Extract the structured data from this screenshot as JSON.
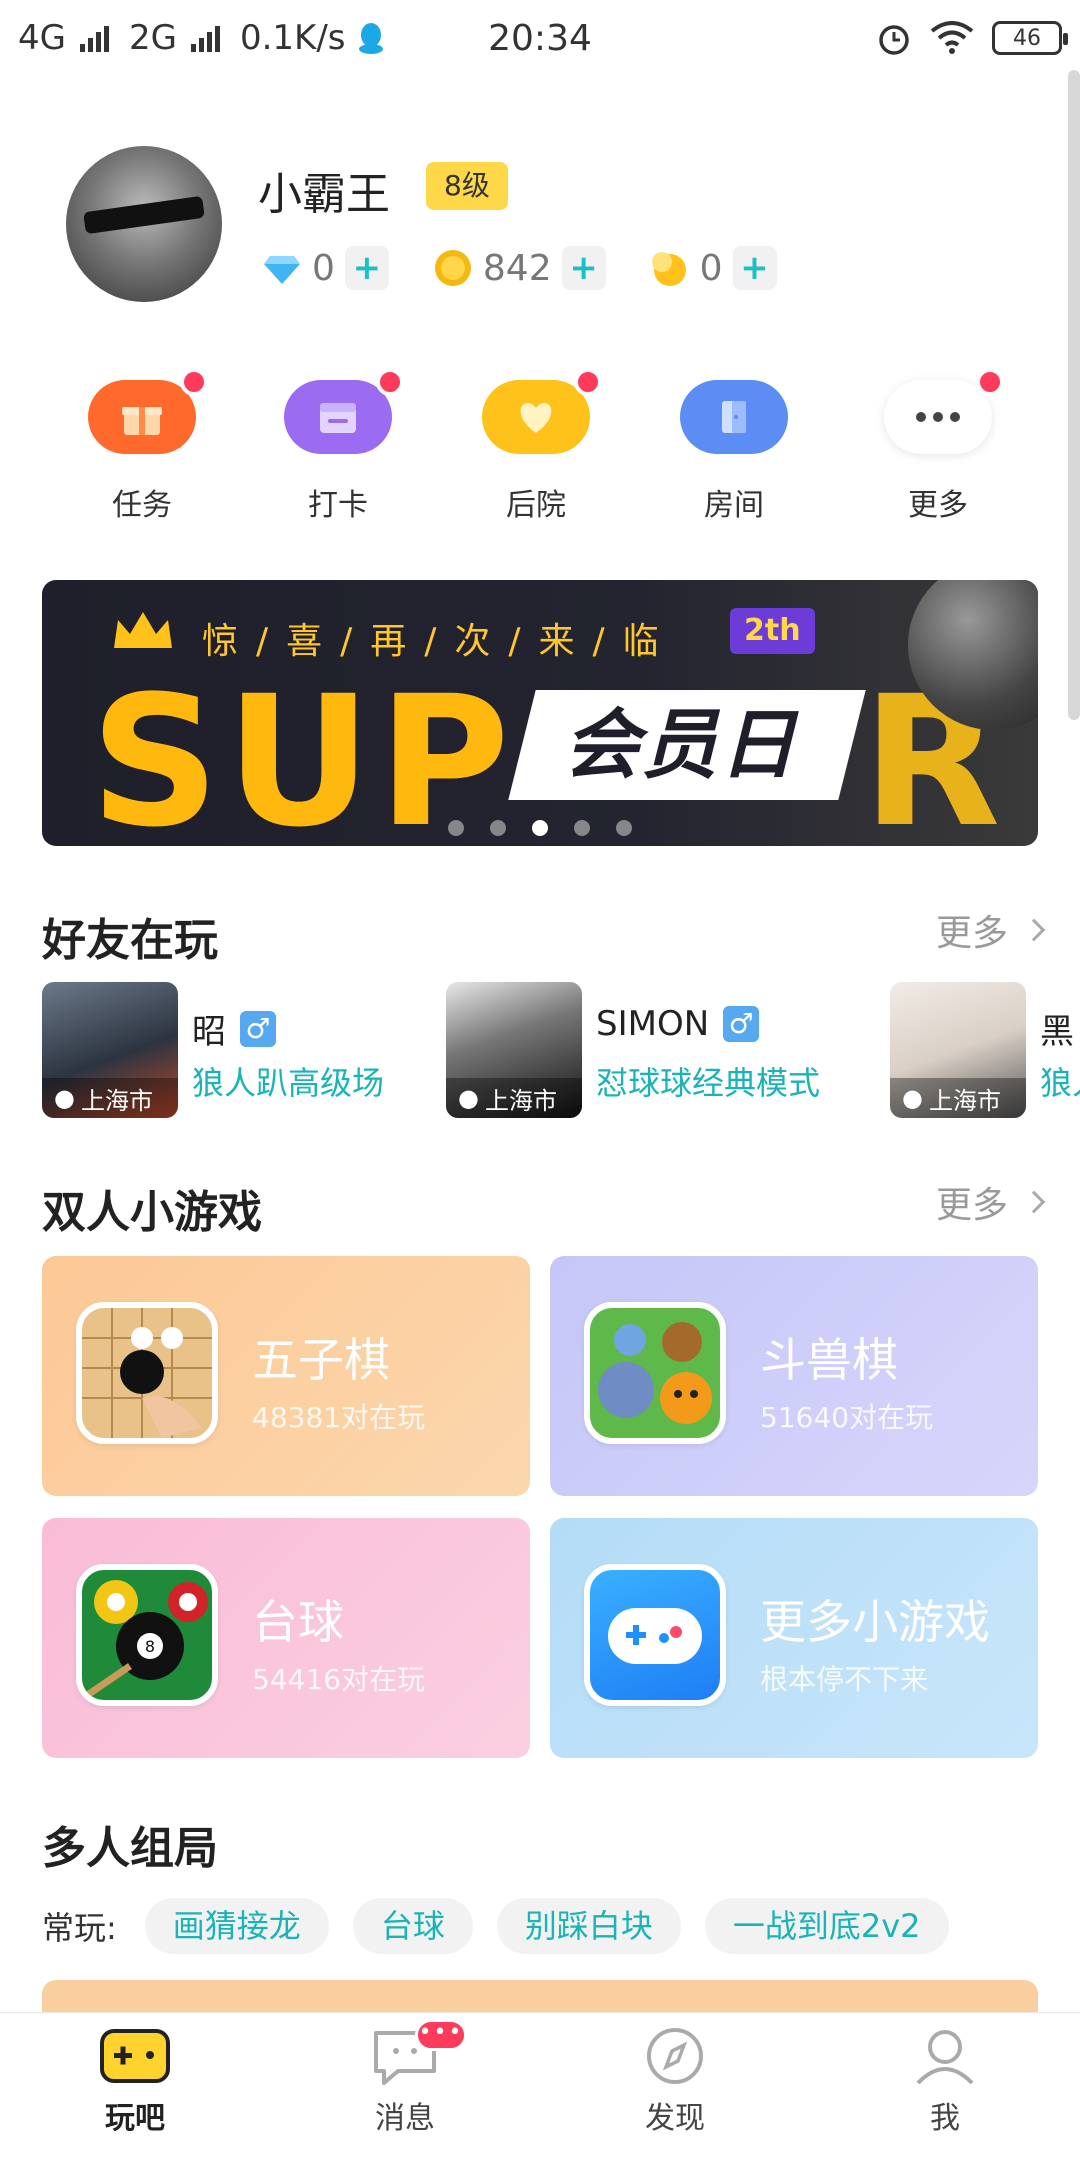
{
  "status_bar": {
    "network": "4G",
    "network2": "2G",
    "speed": "0.1K/s",
    "time": "20:34",
    "battery": "46"
  },
  "profile": {
    "name": "小霸王",
    "level": "8级",
    "diamonds": "0",
    "coins": "842",
    "moons": "0"
  },
  "shortcuts": [
    {
      "label": "任务",
      "color": "#ff6a2c"
    },
    {
      "label": "打卡",
      "color": "#9b6cf2"
    },
    {
      "label": "后院",
      "color": "#ffc21a"
    },
    {
      "label": "房间",
      "color": "#5b8df5"
    },
    {
      "label": "更多",
      "color": "#ffffff"
    }
  ],
  "banner": {
    "top_text": "惊/喜/再/次/来/临",
    "badge": "2th",
    "big_left": "SUP",
    "big_right": "R",
    "slogan": "会员日"
  },
  "friends_section": {
    "title": "好友在玩",
    "more": "更多"
  },
  "friends": [
    {
      "name": "昭",
      "gender": "♂",
      "game": "狼人趴高级场",
      "location": "上海市"
    },
    {
      "name": "SIMON",
      "gender": "♂",
      "game": "怼球球经典模式",
      "location": "上海市"
    },
    {
      "name": "黑",
      "gender": "",
      "game": "狼人",
      "location": "上海市"
    }
  ],
  "duo_section": {
    "title": "双人小游戏",
    "more": "更多"
  },
  "games": [
    {
      "name": "五子棋",
      "sub": "48381对在玩",
      "bg": "#fcc896"
    },
    {
      "name": "斗兽棋",
      "sub": "51640对在玩",
      "bg": "#c6c6f8"
    },
    {
      "name": "台球",
      "sub": "54416对在玩",
      "bg": "#f9bcd6"
    },
    {
      "name": "更多小游戏",
      "sub": "根本停不下来",
      "bg": "#b4dcf7"
    }
  ],
  "multi_section": {
    "title": "多人组局",
    "label": "常玩:",
    "tags": [
      "画猜接龙",
      "台球",
      "别踩白块",
      "一战到底2v2"
    ]
  },
  "tabbar": [
    {
      "label": "玩吧",
      "icon": "gamepad-icon"
    },
    {
      "label": "消息",
      "icon": "chat-icon"
    },
    {
      "label": "发现",
      "icon": "compass-icon"
    },
    {
      "label": "我",
      "icon": "user-icon"
    }
  ]
}
